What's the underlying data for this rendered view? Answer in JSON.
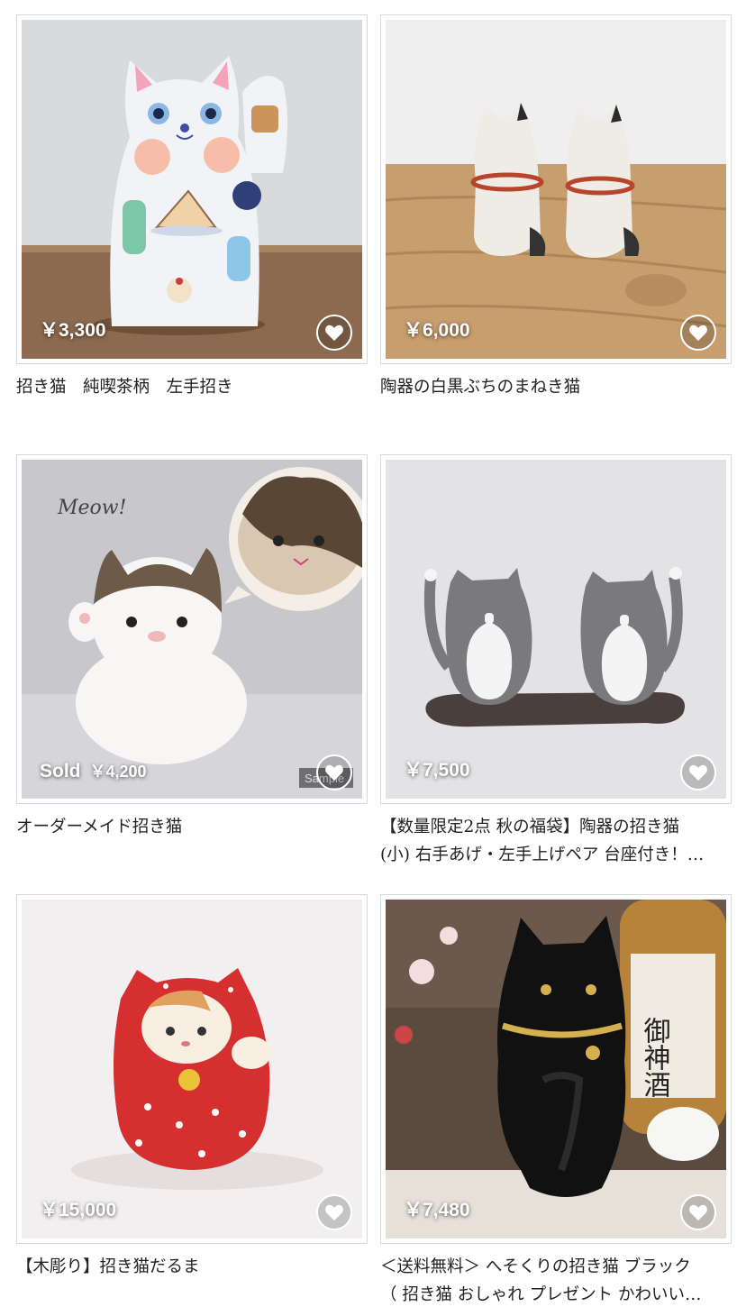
{
  "products": [
    {
      "price": "￥3,300",
      "sold_label": "",
      "title_lines": [
        "招き猫　純喫茶柄　左手招き"
      ],
      "favorite_icon": "heart-icon"
    },
    {
      "price": "￥6,000",
      "sold_label": "",
      "title_lines": [
        "陶器の白黒ぶちのまねき猫"
      ],
      "favorite_icon": "heart-icon"
    },
    {
      "price": "￥4,200",
      "sold_label": "Sold",
      "watermark": "Sample",
      "bubble_text": "Meow!",
      "title_lines": [
        "オーダーメイド招き猫"
      ],
      "favorite_icon": "heart-icon"
    },
    {
      "price": "￥7,500",
      "sold_label": "",
      "title_lines": [
        "【数量限定2点 秋の福袋】陶器の招き猫",
        "(小) 右手あげ・左手上げペア 台座付き！…"
      ],
      "favorite_icon": "heart-icon"
    },
    {
      "price": "￥15,000",
      "sold_label": "",
      "title_lines": [
        "【木彫り】招き猫だるま"
      ],
      "favorite_icon": "heart-icon"
    },
    {
      "price": "￥7,480",
      "sold_label": "",
      "bottle_label": "御神酒",
      "title_lines": [
        "＜送料無料＞ へそくりの招き猫 ブラック",
        "（ 招き猫 おしゃれ プレゼント かわいい…"
      ],
      "favorite_icon": "heart-icon"
    }
  ]
}
